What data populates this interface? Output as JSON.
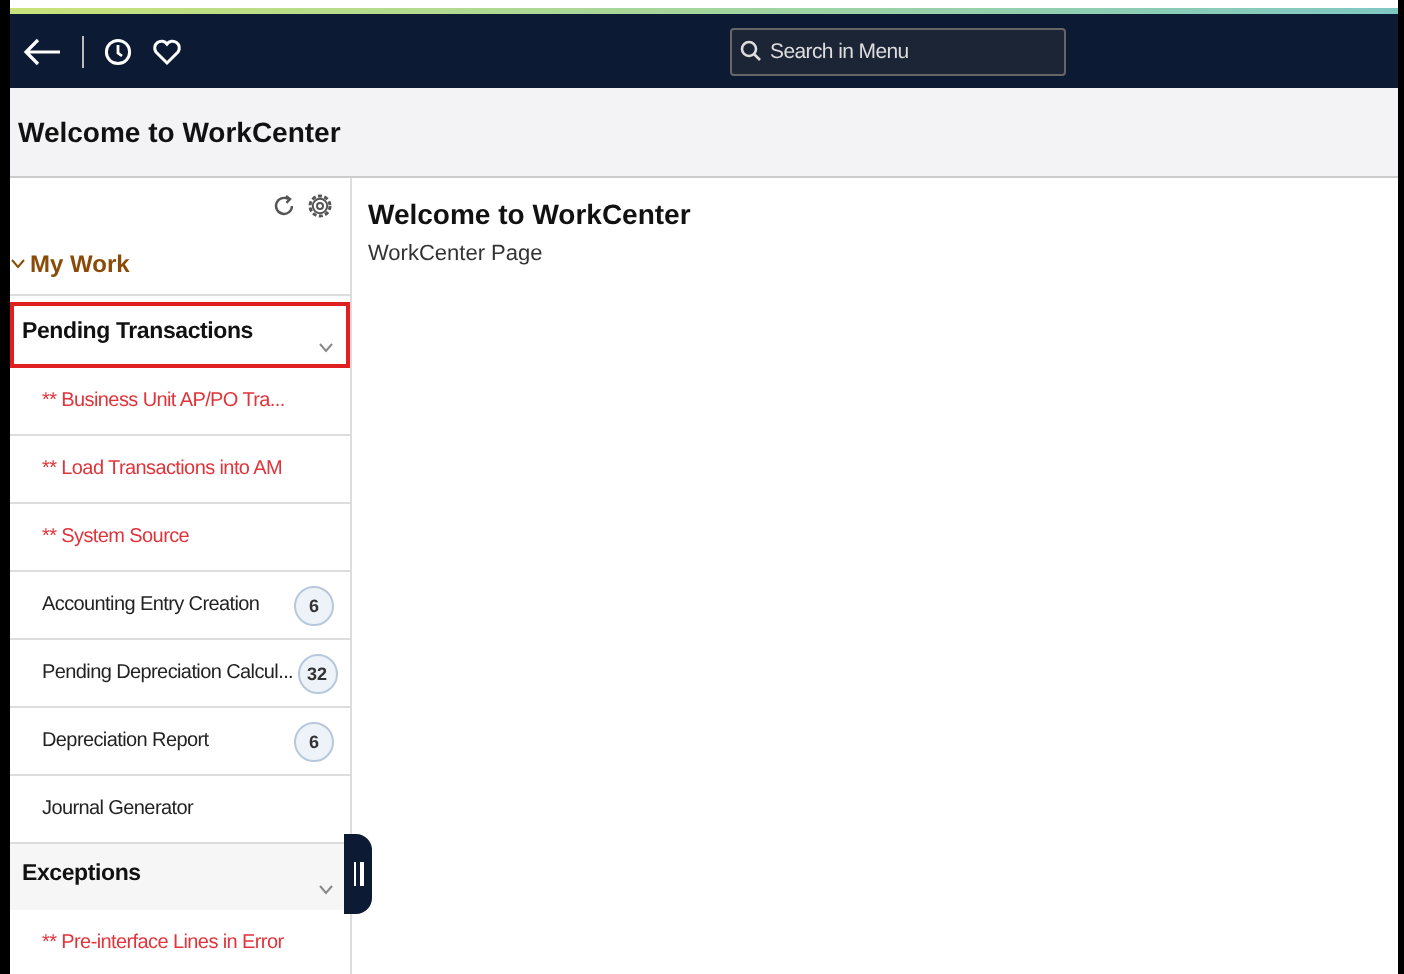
{
  "nav": {
    "search": {
      "placeholder": "Search in Menu"
    }
  },
  "page_title": "Welcome to WorkCenter",
  "sidebar": {
    "group": {
      "label": "My Work",
      "expanded": true
    },
    "sections": [
      {
        "label": "Pending Transactions",
        "selected": true,
        "expanded": true,
        "items": [
          {
            "label": "** Business Unit AP/PO Tra...",
            "kind": "alert"
          },
          {
            "label": "** Load Transactions into AM",
            "kind": "alert"
          },
          {
            "label": "** System Source",
            "kind": "alert"
          },
          {
            "label": "Accounting Entry Creation",
            "kind": "task",
            "count": "6"
          },
          {
            "label": "Pending Depreciation Calcul...",
            "kind": "task",
            "count": "32"
          },
          {
            "label": "Depreciation Report",
            "kind": "task",
            "count": "6"
          },
          {
            "label": "Journal Generator",
            "kind": "task"
          }
        ]
      },
      {
        "label": "Exceptions",
        "selected": false,
        "expanded": true,
        "items": [
          {
            "label": "** Pre-interface Lines in Error",
            "kind": "alert"
          }
        ]
      }
    ]
  },
  "content": {
    "title": "Welcome to WorkCenter",
    "subtitle": "WorkCenter Page"
  }
}
